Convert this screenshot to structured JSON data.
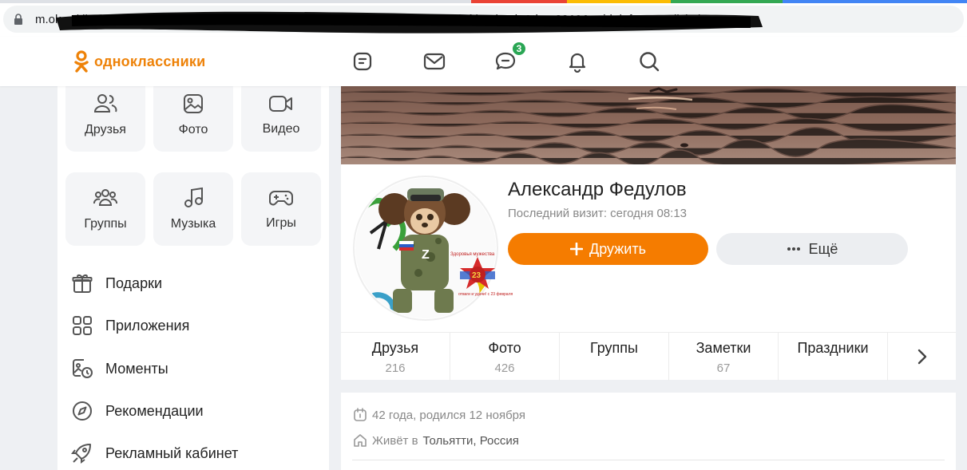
{
  "browser": {
    "url": "m.ok.ru/dk?st.cmd=friendMain&st.friendId=...&st.frwd=on&st.page=1&_prevCmd=friendMain&tkn=3369&_aid=leftMenuClick#lp"
  },
  "header": {
    "logo_text": "одноклассники",
    "nav_icons": [
      "feed-icon",
      "messages-icon",
      "discussions-icon",
      "notifications-icon",
      "search-icon"
    ],
    "discussions_badge": "3",
    "brand_color": "#ee8208"
  },
  "sidebar": {
    "tiles": [
      {
        "label": "Друзья",
        "icon": "friends-icon"
      },
      {
        "label": "Фото",
        "icon": "photo-icon"
      },
      {
        "label": "Видео",
        "icon": "video-icon"
      },
      {
        "label": "Группы",
        "icon": "groups-icon"
      },
      {
        "label": "Музыка",
        "icon": "music-icon"
      },
      {
        "label": "Игры",
        "icon": "gamepad-icon"
      }
    ],
    "menu": [
      {
        "label": "Подарки",
        "icon": "gift-icon"
      },
      {
        "label": "Приложения",
        "icon": "apps-icon"
      },
      {
        "label": "Моменты",
        "icon": "moments-icon"
      },
      {
        "label": "Рекомендации",
        "icon": "compass-icon"
      },
      {
        "label": "Рекламный кабинет",
        "icon": "rocket-icon"
      }
    ]
  },
  "profile": {
    "name": "Александр Федулов",
    "last_visit": "Последний визит: сегодня 08:13",
    "add_friend_label": "Дружить",
    "more_label": "Ещё",
    "avatar_badge_text": "Z",
    "avatar_sticker_number": "23",
    "avatar_sticker_top": "Здоровья мужества",
    "avatar_sticker_bottom": "отваги и удачи! с 23 февраля",
    "accent_color": "#f57c00"
  },
  "tabs": [
    {
      "label": "Друзья",
      "count": "216"
    },
    {
      "label": "Фото",
      "count": "426"
    },
    {
      "label": "Группы",
      "count": ""
    },
    {
      "label": "Заметки",
      "count": "67"
    },
    {
      "label": "Праздники",
      "count": ""
    }
  ],
  "info": {
    "age": "42 года, родился 12 ноября",
    "lives_prefix": "Живёт в",
    "city": "Тольятти, Россия"
  }
}
